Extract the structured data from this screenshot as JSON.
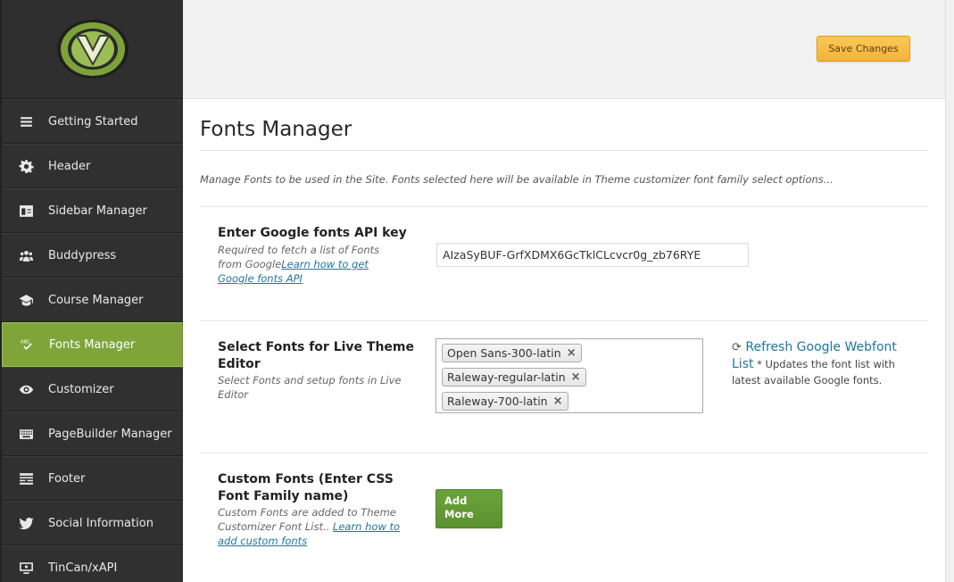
{
  "header": {
    "save_label": "Save Changes"
  },
  "sidebar": {
    "items": [
      {
        "label": "Getting Started",
        "icon": "menu-icon"
      },
      {
        "label": "Header",
        "icon": "gear-icon"
      },
      {
        "label": "Sidebar Manager",
        "icon": "sidebar-icon"
      },
      {
        "label": "Buddypress",
        "icon": "group-icon"
      },
      {
        "label": "Course Manager",
        "icon": "graduation-cap-icon"
      },
      {
        "label": "Fonts Manager",
        "icon": "abc-check-icon",
        "active": true
      },
      {
        "label": "Customizer",
        "icon": "eye-icon"
      },
      {
        "label": "PageBuilder Manager",
        "icon": "keyboard-icon"
      },
      {
        "label": "Footer",
        "icon": "footer-icon"
      },
      {
        "label": "Social Information",
        "icon": "twitter-icon"
      },
      {
        "label": "TinCan/xAPI",
        "icon": "screen-icon"
      }
    ]
  },
  "main": {
    "title": "Fonts Manager",
    "description": "Manage Fonts to be used in the Site. Fonts selected here will be available in Theme customizer font family select options...",
    "api_key": {
      "title": "Enter Google fonts API key",
      "help_line1": "Required to fetch a list of Fonts",
      "help_line2_prefix": "from Google",
      "help_link_line1": "Learn how to get",
      "help_link_line2": "Google fonts API",
      "value": "AIzaSyBUF-GrfXDMX6GcTklCLcvcr0g_zb76RYE"
    },
    "select_fonts": {
      "title_line1": "Select Fonts for Live Theme",
      "title_line2": "Editor",
      "help_line1": "Select Fonts and setup fonts in Live",
      "help_line2": "Editor",
      "tags": [
        "Open Sans-300-latin",
        "Raleway-regular-latin",
        "Raleway-700-latin"
      ],
      "refresh_line1": "Refresh Google Webfont",
      "refresh_line2": "List",
      "refresh_note_line1": "* Updates the font list with",
      "refresh_note_line2": "latest available Google fonts."
    },
    "custom_fonts": {
      "title_line1": "Custom Fonts (Enter CSS",
      "title_line2": "Font Family name)",
      "help_line1": "Custom Fonts are added to Theme",
      "help_line2_prefix": "Customizer Font List..",
      "help_link_line1": "Learn how to",
      "help_link_line2": "add custom fonts",
      "add_line1": "Add",
      "add_line2": "More"
    }
  },
  "colors": {
    "sidebar_bg": "#303030",
    "active_bg": "#7fa53a",
    "save_button": "#f4b33a",
    "add_button": "#5b9230",
    "link": "#21759b"
  }
}
